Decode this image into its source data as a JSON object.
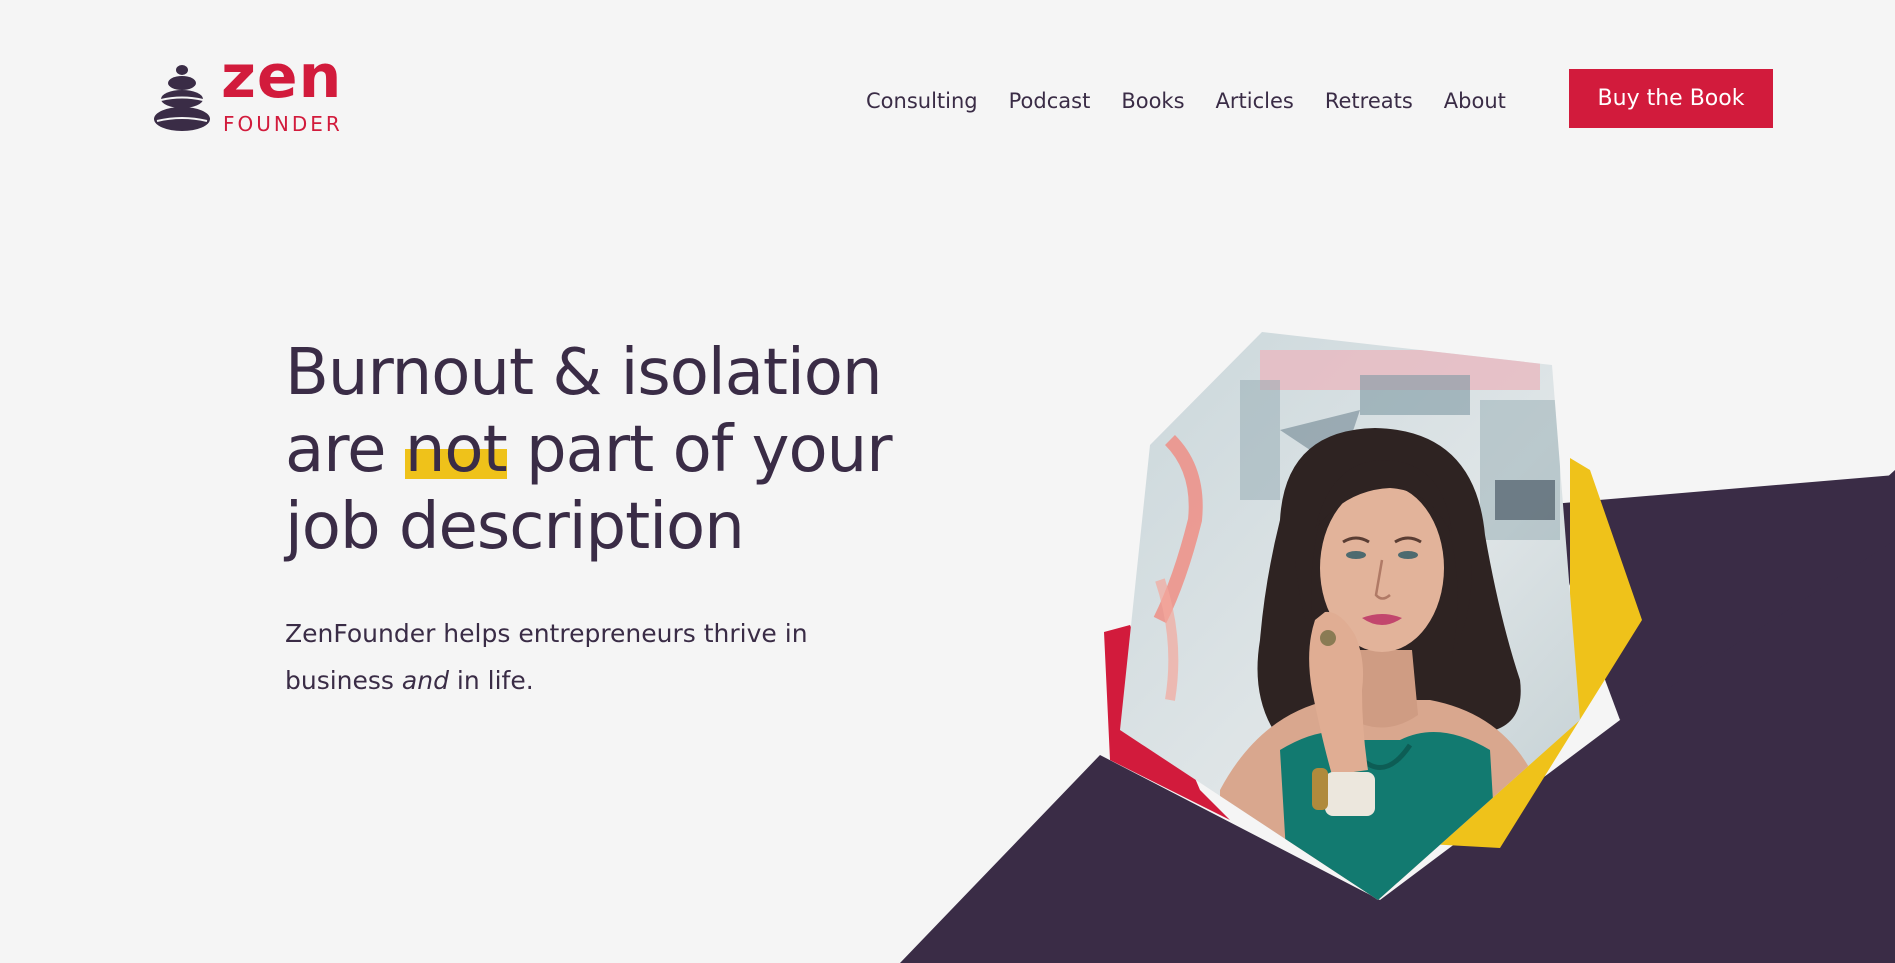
{
  "brand": {
    "logo_primary": "zen",
    "logo_secondary": "FOUNDER",
    "logo_icon": "stacked-stones-icon"
  },
  "nav": {
    "items": [
      {
        "label": "Consulting"
      },
      {
        "label": "Podcast"
      },
      {
        "label": "Books"
      },
      {
        "label": "Articles"
      },
      {
        "label": "Retreats"
      },
      {
        "label": "About"
      }
    ],
    "cta_label": "Buy the Book"
  },
  "hero": {
    "headline_line1": "Burnout & isolation",
    "headline_line2_pre": "are ",
    "headline_line2_highlight": "not",
    "headline_line2_post": " part of your",
    "headline_line3": "job description",
    "subtext_line1": "ZenFounder helps entrepreneurs thrive in",
    "subtext_line2_pre": "business ",
    "subtext_line2_em": "and",
    "subtext_line2_post": " in life."
  },
  "colors": {
    "background": "#f5f5f5",
    "brand_red": "#d21b3c",
    "accent_yellow": "#efc21a",
    "dark_purple": "#3a2c46"
  }
}
